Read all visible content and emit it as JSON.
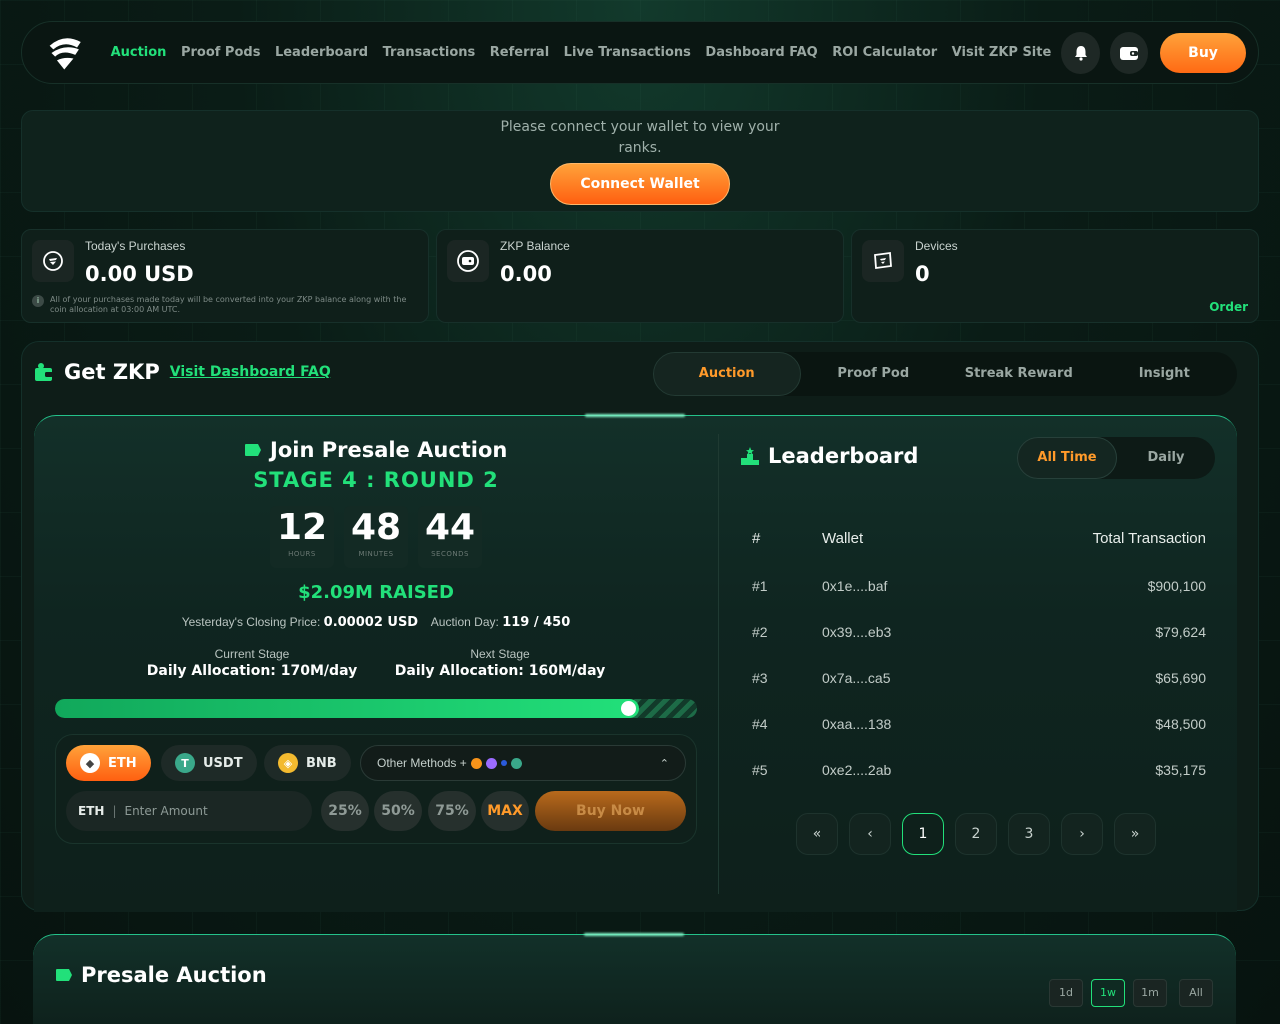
{
  "nav": {
    "links": [
      "Auction",
      "Proof Pods",
      "Leaderboard",
      "Transactions",
      "Referral",
      "Live Transactions",
      "Dashboard FAQ",
      "ROI Calculator",
      "Visit ZKP Site"
    ],
    "buy_label": "Buy",
    "accent": "#22e07a"
  },
  "connect": {
    "message": "Please connect your wallet to view your ranks.",
    "button": "Connect Wallet"
  },
  "stats": [
    {
      "label": "Today's Purchases",
      "value": "0.00 USD",
      "note": "All of your purchases made today will be converted into your ZKP balance along with the coin allocation at 03:00 AM UTC."
    },
    {
      "label": "ZKP Balance",
      "value": "0.00"
    },
    {
      "label": "Devices",
      "value": "0",
      "link": "Order"
    }
  ],
  "get": {
    "title": "Get ZKP",
    "faq_link": "Visit Dashboard FAQ",
    "tabs": [
      "Auction",
      "Proof Pod",
      "Streak Reward",
      "Insight"
    ]
  },
  "auction": {
    "title": "Join Presale Auction",
    "stage": "STAGE 4 : ROUND 2",
    "timer": [
      {
        "value": "12",
        "unit": "HOURS"
      },
      {
        "value": "48",
        "unit": "MINUTES"
      },
      {
        "value": "44",
        "unit": "SECONDS"
      }
    ],
    "raised": "$2.09M RAISED",
    "closing_price_label": "Yesterday's Closing Price:",
    "closing_price": "0.00002 USD",
    "auction_day_label": "Auction Day:",
    "auction_day": "119 / 450",
    "current_stage_label": "Current Stage",
    "current_alloc": "Daily Allocation: 170M/day",
    "next_stage_label": "Next Stage",
    "next_alloc": "Daily Allocation: 160M/day",
    "progress": 0.91,
    "coins": [
      "ETH",
      "USDT",
      "BNB"
    ],
    "other_methods": "Other Methods +",
    "amount_currency": "ETH",
    "amount_placeholder": "Enter Amount",
    "percent_buttons": [
      "25%",
      "50%",
      "75%",
      "MAX"
    ],
    "buy_now": "Buy Now"
  },
  "leaderboard": {
    "title": "Leaderboard",
    "tabs": [
      "All Time",
      "Daily"
    ],
    "headers": [
      "#",
      "Wallet",
      "Total Transaction"
    ],
    "rows": [
      {
        "rank": "#1",
        "wallet": "0x1e....baf",
        "total": "$900,100"
      },
      {
        "rank": "#2",
        "wallet": "0x39....eb3",
        "total": "$79,624"
      },
      {
        "rank": "#3",
        "wallet": "0x7a....ca5",
        "total": "$65,690"
      },
      {
        "rank": "#4",
        "wallet": "0xaa....138",
        "total": "$48,500"
      },
      {
        "rank": "#5",
        "wallet": "0xe2....2ab",
        "total": "$35,175"
      }
    ],
    "pages": [
      "1",
      "2",
      "3"
    ]
  },
  "presale": {
    "title": "Presale Auction",
    "ranges": [
      "1d",
      "1w",
      "1m",
      "All"
    ]
  }
}
